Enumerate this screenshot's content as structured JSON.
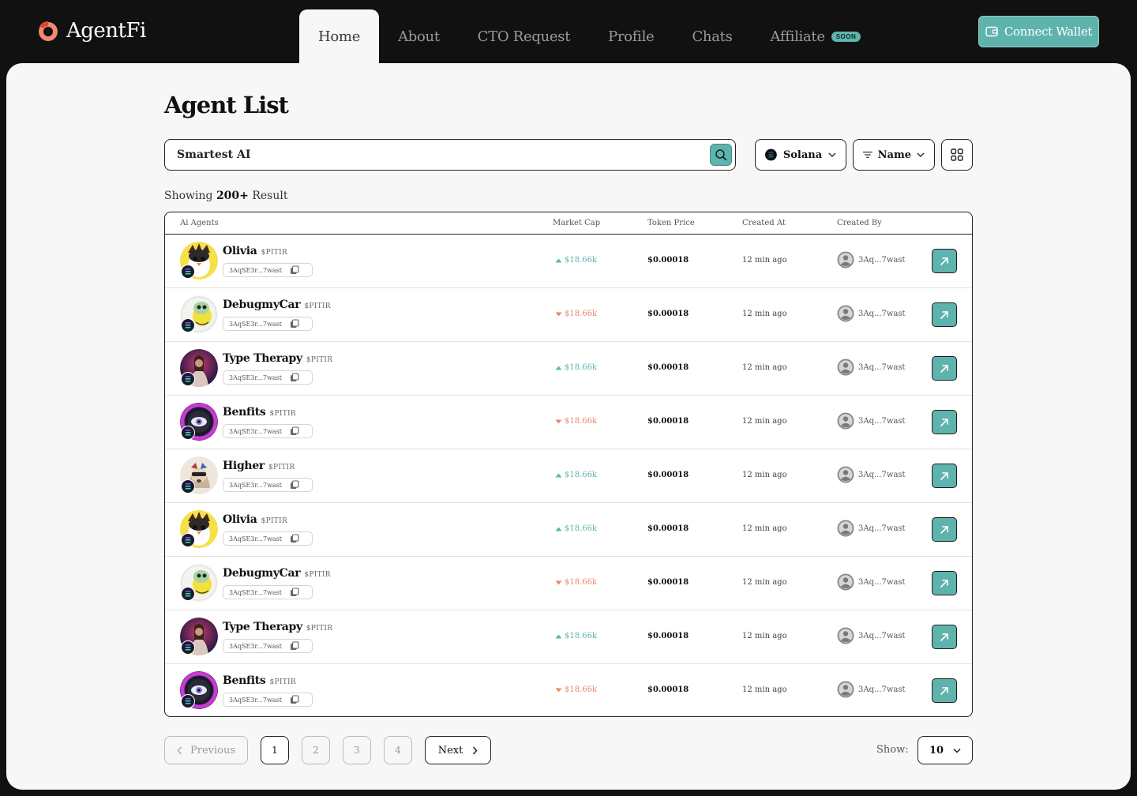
{
  "brand": {
    "name": "AgentFi",
    "accent": "#5fb3ad"
  },
  "nav": {
    "items": [
      {
        "label": "Home",
        "active": true
      },
      {
        "label": "About"
      },
      {
        "label": "CTO Request"
      },
      {
        "label": "Profile"
      },
      {
        "label": "Chats"
      },
      {
        "label": "Affiliate",
        "badge": "SOON"
      }
    ]
  },
  "header": {
    "connect_label": "Connect Wallet",
    "wallet_icon": "wallet-icon"
  },
  "page": {
    "title": "Agent List"
  },
  "search": {
    "value": "Smartest AI",
    "icon": "search-icon"
  },
  "filters": {
    "chain": "Solana",
    "sort": "Name"
  },
  "results": {
    "prefix": "Showing",
    "count": "200+",
    "suffix": "Result"
  },
  "table": {
    "columns": [
      "Ai Agents",
      "Market Cap",
      "Token Price",
      "Created At",
      "Created By"
    ],
    "rows": [
      {
        "name": "Olivia",
        "ticker": "$PITIR",
        "address": "3AqSE3r...7wast",
        "trend": "up",
        "market_cap": "$18.66k",
        "price": "$0.00018",
        "created_at": "12 min ago",
        "creator": "3Aq...7wast",
        "avatar": "bird"
      },
      {
        "name": "DebugmyCar",
        "ticker": "$PITIR",
        "address": "3AqSE3r...7wast",
        "trend": "down",
        "market_cap": "$18.66k",
        "price": "$0.00018",
        "created_at": "12 min ago",
        "creator": "3Aq...7wast",
        "avatar": "frog"
      },
      {
        "name": "Type Therapy",
        "ticker": "$PITIR",
        "address": "3AqSE3r...7wast",
        "trend": "up",
        "market_cap": "$18.66k",
        "price": "$0.00018",
        "created_at": "12 min ago",
        "creator": "3Aq...7wast",
        "avatar": "figure"
      },
      {
        "name": "Benfits",
        "ticker": "$PITIR",
        "address": "3AqSE3r...7wast",
        "trend": "down",
        "market_cap": "$18.66k",
        "price": "$0.00018",
        "created_at": "12 min ago",
        "creator": "3Aq...7wast",
        "avatar": "eye"
      },
      {
        "name": "Higher",
        "ticker": "$PITIR",
        "address": "3AqSE3r...7wast",
        "trend": "up",
        "market_cap": "$18.66k",
        "price": "$0.00018",
        "created_at": "12 min ago",
        "creator": "3Aq...7wast",
        "avatar": "dog"
      },
      {
        "name": "Olivia",
        "ticker": "$PITIR",
        "address": "3AqSE3r...7wast",
        "trend": "up",
        "market_cap": "$18.66k",
        "price": "$0.00018",
        "created_at": "12 min ago",
        "creator": "3Aq...7wast",
        "avatar": "bird"
      },
      {
        "name": "DebugmyCar",
        "ticker": "$PITIR",
        "address": "3AqSE3r...7wast",
        "trend": "down",
        "market_cap": "$18.66k",
        "price": "$0.00018",
        "created_at": "12 min ago",
        "creator": "3Aq...7wast",
        "avatar": "frog"
      },
      {
        "name": "Type Therapy",
        "ticker": "$PITIR",
        "address": "3AqSE3r...7wast",
        "trend": "up",
        "market_cap": "$18.66k",
        "price": "$0.00018",
        "created_at": "12 min ago",
        "creator": "3Aq...7wast",
        "avatar": "figure"
      },
      {
        "name": "Benfits",
        "ticker": "$PITIR",
        "address": "3AqSE3r...7wast",
        "trend": "down",
        "market_cap": "$18.66k",
        "price": "$0.00018",
        "created_at": "12 min ago",
        "creator": "3Aq...7wast",
        "avatar": "eye"
      }
    ]
  },
  "pagination": {
    "previous_label": "Previous",
    "next_label": "Next",
    "pages": [
      "1",
      "2",
      "3",
      "4"
    ],
    "current": "1",
    "show_label": "Show:",
    "show_value": "10"
  },
  "colors": {
    "up": "#5fb3ad",
    "down": "#e8866d",
    "background": "#111111",
    "panel": "#f7f7f7"
  }
}
